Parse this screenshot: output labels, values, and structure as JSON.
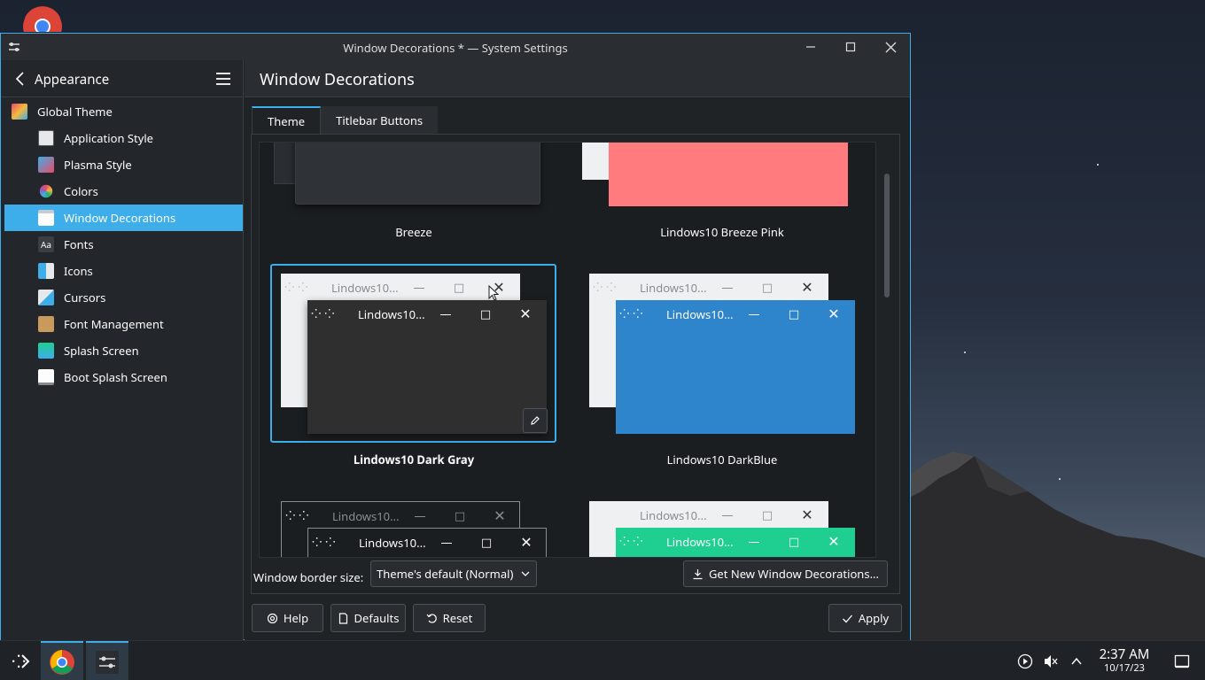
{
  "window": {
    "title": "Window Decorations * — System Settings"
  },
  "sidebar": {
    "header": "Appearance",
    "items": [
      {
        "label": "Global Theme",
        "icon": "global-theme-icon"
      },
      {
        "label": "Application Style",
        "icon": "application-style-icon"
      },
      {
        "label": "Plasma Style",
        "icon": "plasma-style-icon"
      },
      {
        "label": "Colors",
        "icon": "colors-icon"
      },
      {
        "label": "Window Decorations",
        "icon": "window-decorations-icon",
        "active": true
      },
      {
        "label": "Fonts",
        "icon": "fonts-icon"
      },
      {
        "label": "Icons",
        "icon": "icons-icon"
      },
      {
        "label": "Cursors",
        "icon": "cursors-icon"
      },
      {
        "label": "Font Management",
        "icon": "font-management-icon"
      },
      {
        "label": "Splash Screen",
        "icon": "splash-screen-icon"
      },
      {
        "label": "Boot Splash Screen",
        "icon": "boot-splash-screen-icon"
      }
    ]
  },
  "main": {
    "title": "Window Decorations",
    "tabs": [
      {
        "label": "Theme",
        "active": true
      },
      {
        "label": "Titlebar Buttons",
        "active": false
      }
    ],
    "themes": [
      {
        "name": "Breeze",
        "selected": false
      },
      {
        "name": "Lindows10 Breeze Pink",
        "selected": false
      },
      {
        "name": "Lindows10 Dark Gray",
        "selected": true
      },
      {
        "name": "Lindows10 DarkBlue",
        "selected": false
      }
    ],
    "preview_caption": "Lindows10...",
    "border_size_label": "Window border size:",
    "border_size_value": "Theme's default (Normal)",
    "get_new_label": "Get New Window Decorations...",
    "help_label": "Help",
    "defaults_label": "Defaults",
    "reset_label": "Reset",
    "apply_label": "Apply"
  },
  "taskbar": {
    "time": "2:37 AM",
    "date": "10/17/23"
  },
  "colors": {
    "accent": "#3daee9",
    "pink": "#ff7b7d",
    "darkblue": "#2f85cb",
    "teal": "#1fcf92"
  }
}
